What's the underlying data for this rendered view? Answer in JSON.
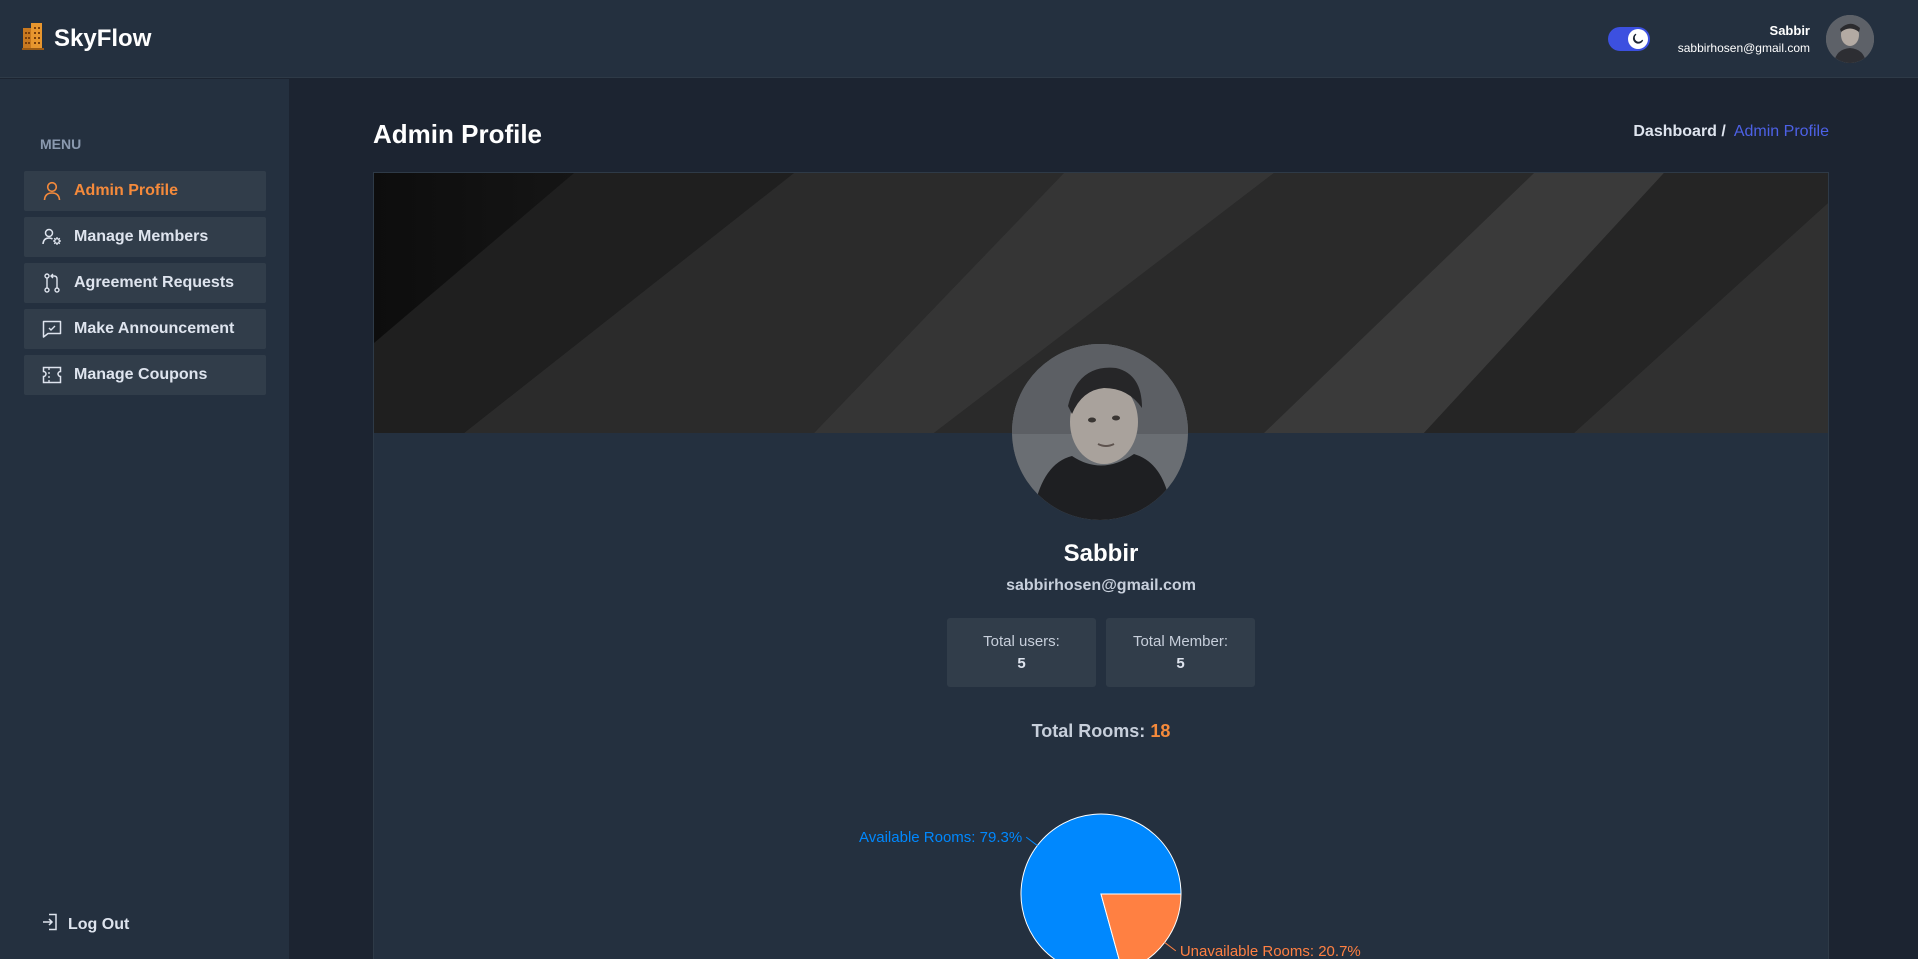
{
  "app": {
    "name": "SkyFlow",
    "theme_toggle": "dark"
  },
  "header": {
    "user_name": "Sabbir",
    "user_email": "sabbirhosen@gmail.com"
  },
  "sidebar": {
    "menu_title": "MENU",
    "items": [
      {
        "label": "Admin Profile",
        "icon": "user-icon",
        "active": true
      },
      {
        "label": "Manage Members",
        "icon": "users-gear-icon",
        "active": false
      },
      {
        "label": "Agreement Requests",
        "icon": "git-pull-request-icon",
        "active": false
      },
      {
        "label": "Make Announcement",
        "icon": "message-square-icon",
        "active": false
      },
      {
        "label": "Manage Coupons",
        "icon": "ticket-icon",
        "active": false
      }
    ],
    "logout_label": "Log Out"
  },
  "page": {
    "title": "Admin Profile",
    "breadcrumb": {
      "parent": "Dashboard /",
      "current": "Admin Profile"
    }
  },
  "profile": {
    "name": "Sabbir",
    "email": "sabbirhosen@gmail.com",
    "stats": [
      {
        "label": "Total users:",
        "value": "5"
      },
      {
        "label": "Total Member:",
        "value": "5"
      }
    ],
    "rooms_label": "Total Rooms:",
    "rooms_value": "18"
  },
  "chart_data": {
    "type": "pie",
    "labels": [
      "Available Rooms: 79.3%",
      "Unavailable Rooms: 20.7%"
    ],
    "categories": [
      "Available Rooms",
      "Unavailable Rooms"
    ],
    "values": [
      79.3,
      20.7
    ],
    "colors": [
      "#0088fe",
      "#ff8042"
    ]
  },
  "colors": {
    "accent": "#3c50e0",
    "active": "#f58a3b",
    "pie_available": "#0088fe",
    "pie_unavailable": "#ff8042"
  }
}
